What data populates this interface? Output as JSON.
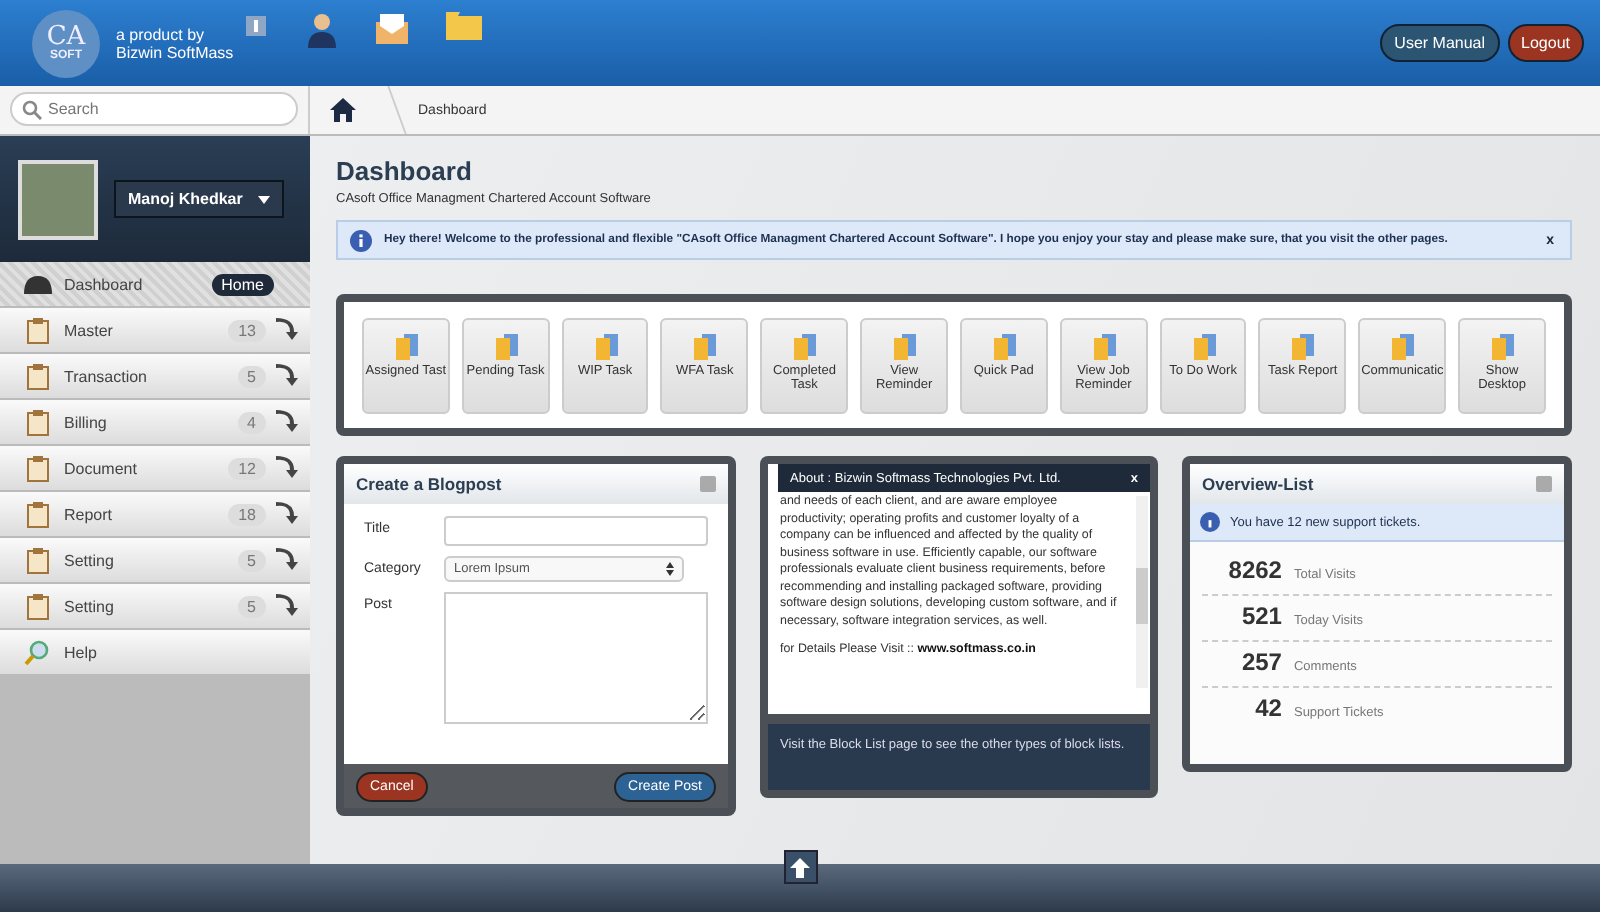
{
  "header": {
    "logo": {
      "top": "CA",
      "bottom": "SOFT"
    },
    "tagline_1": "a product by",
    "tagline_2": "Bizwin SoftMass",
    "buttons": [
      {
        "label": "User Manual",
        "kind": "default"
      },
      {
        "label": "Logout",
        "kind": "danger"
      }
    ]
  },
  "search": {
    "placeholder": "Search"
  },
  "breadcrumb": [
    "Dashboard"
  ],
  "profile": {
    "name": "Manoj Khedkar"
  },
  "sidebar": {
    "items": [
      {
        "label": "Dashboard",
        "badge": "Home",
        "kind": "home",
        "selected": true
      },
      {
        "label": "Master",
        "badge": "13",
        "kind": "menu",
        "selected": false
      },
      {
        "label": "Transaction",
        "badge": "5",
        "kind": "menu",
        "selected": false
      },
      {
        "label": "Billing",
        "badge": "4",
        "kind": "menu",
        "selected": false
      },
      {
        "label": "Document",
        "badge": "12",
        "kind": "menu",
        "selected": false
      },
      {
        "label": "Report",
        "badge": "18",
        "kind": "menu",
        "selected": false
      },
      {
        "label": "Setting",
        "badge": "5",
        "kind": "menu",
        "selected": false
      },
      {
        "label": "Setting",
        "badge": "5",
        "kind": "menu",
        "selected": false
      },
      {
        "label": "Help",
        "kind": "help",
        "selected": false
      }
    ]
  },
  "page": {
    "title": "Dashboard",
    "subtitle": "CAsoft Office Managment Chartered Account Software"
  },
  "alert": {
    "text": "Hey there! Welcome to the professional and flexible \"CAsoft Office Managment Chartered Account Software\". I hope you enjoy your stay and please make sure, that you visit the other pages.",
    "close": "x"
  },
  "shortcuts": [
    "Assigned Tast",
    "Pending Task",
    "WIP Task",
    "WFA Task",
    "Completed Task",
    "View Reminder",
    "Quick Pad",
    "View Job Reminder",
    "To Do Work",
    "Task Report",
    "Communicatic",
    "Show Desktop"
  ],
  "blogpost": {
    "title": "Create a Blogpost",
    "fields": [
      {
        "label": "Title",
        "kind": "text"
      },
      {
        "label": "Category",
        "kind": "select",
        "value": "Lorem Ipsum"
      },
      {
        "label": "Post",
        "kind": "textarea"
      }
    ],
    "cancel": "Cancel",
    "submit": "Create Post"
  },
  "about": {
    "title": "About : Bizwin Softmass Technologies Pvt. Ltd.",
    "close": "x",
    "body": "and needs of each client, and are aware employee productivity; operating profits and customer loyalty of a company can be influenced and affected by the quality of business software in use. Efficiently capable, our software professionals evaluate client business requirements, before recommending and installing packaged software, providing software design solutions, developing custom software, and if necessary, software integration services, as well.",
    "visit": "for Details Please Visit ::",
    "link": "www.softmass.co.in",
    "footer": "Visit the Block List page to see the other types of block lists."
  },
  "overview": {
    "title": "Overview-List",
    "notice": "You have 12 new support tickets.",
    "stats": [
      {
        "value": "8262",
        "label": "Total Visits"
      },
      {
        "value": "521",
        "label": "Today Visits"
      },
      {
        "value": "257",
        "label": "Comments"
      },
      {
        "value": "42",
        "label": "Support Tickets"
      }
    ]
  }
}
